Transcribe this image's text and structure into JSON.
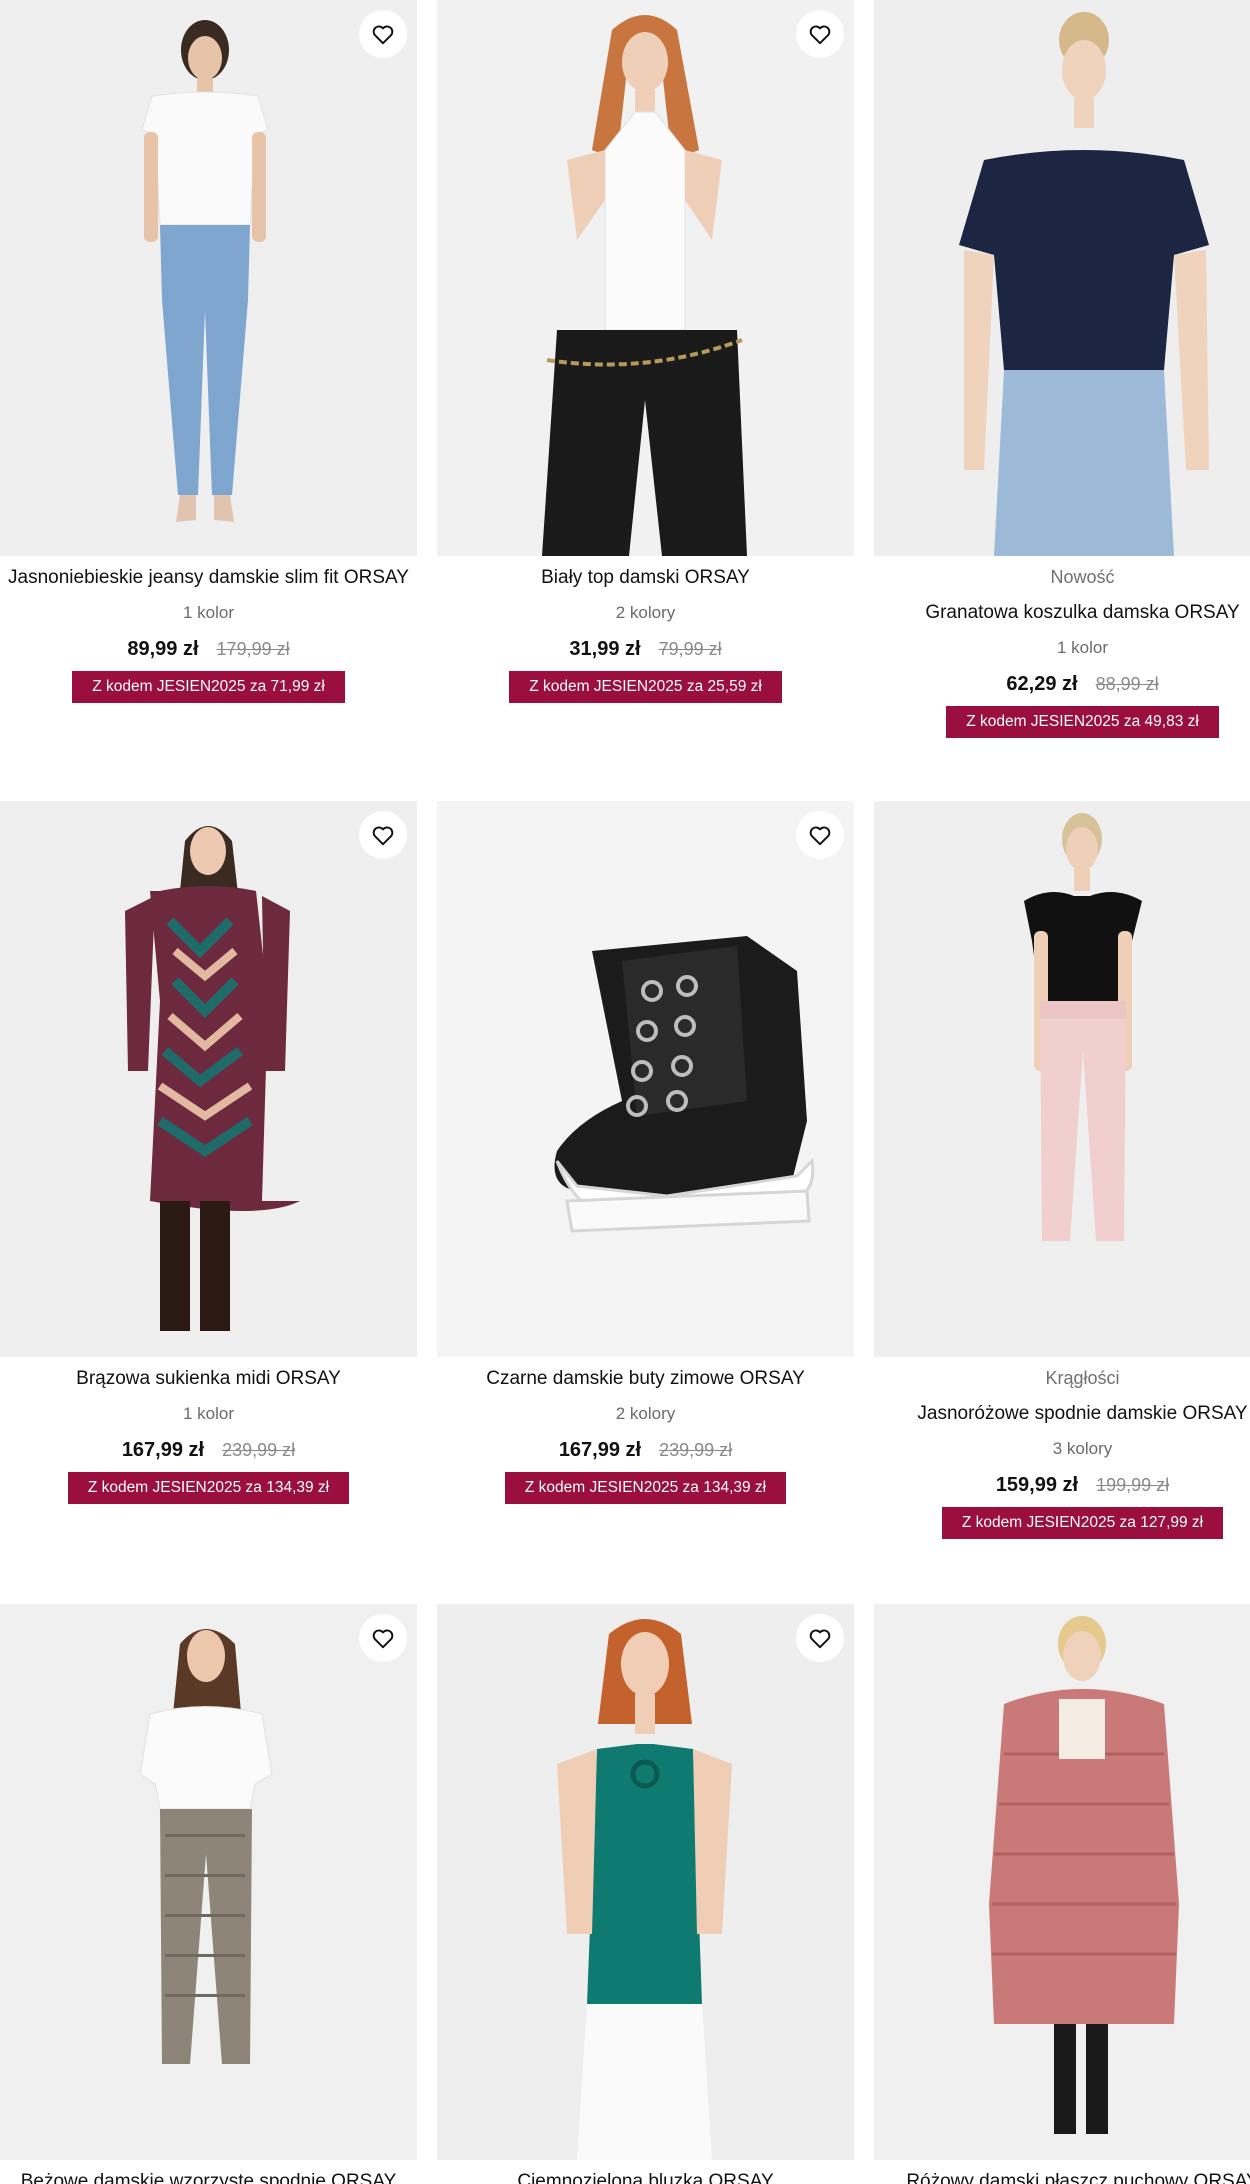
{
  "icons": {
    "favorite": "heart-outline-icon"
  },
  "colors": {
    "promo_bg": "#9b0f3f",
    "image_bg": "#eeeeef",
    "old_price": "#8a8a8a"
  },
  "products": [
    {
      "tag": "",
      "name": "Jasnoniebieskie jeansy damskie slim fit ORSAY",
      "colors": "1 kolor",
      "price": "89,99 zł",
      "old_price": "179,99 zł",
      "promo": "Z kodem JESIEN2025 za 71,99 zł"
    },
    {
      "tag": "",
      "name": "Biały top damski ORSAY",
      "colors": "2 kolory",
      "price": "31,99 zł",
      "old_price": "79,99 zł",
      "promo": "Z kodem JESIEN2025 za 25,59 zł"
    },
    {
      "tag": "Nowość",
      "name": "Granatowa koszulka damska ORSAY",
      "colors": "1 kolor",
      "price": "62,29 zł",
      "old_price": "88,99 zł",
      "promo": "Z kodem JESIEN2025 za 49,83 zł"
    },
    {
      "tag": "",
      "name": "Brązowa sukienka midi ORSAY",
      "colors": "1 kolor",
      "price": "167,99 zł",
      "old_price": "239,99 zł",
      "promo": "Z kodem JESIEN2025 za 134,39 zł"
    },
    {
      "tag": "",
      "name": "Czarne damskie buty zimowe ORSAY",
      "colors": "2 kolory",
      "price": "167,99 zł",
      "old_price": "239,99 zł",
      "promo": "Z kodem JESIEN2025 za 134,39 zł"
    },
    {
      "tag": "Krągłości",
      "name": "Jasnoróżowe spodnie damskie ORSAY",
      "colors": "3 kolory",
      "price": "159,99 zł",
      "old_price": "199,99 zł",
      "promo": "Z kodem JESIEN2025 za 127,99 zł"
    },
    {
      "tag": "",
      "name": "Beżowe damskie wzorzyste spodnie ORSAY",
      "colors": "",
      "price": "",
      "old_price": "",
      "promo": ""
    },
    {
      "tag": "",
      "name": "Ciemnozielona bluzka ORSAY",
      "colors": "",
      "price": "",
      "old_price": "",
      "promo": ""
    },
    {
      "tag": "",
      "name": "Różowy damski płaszcz puchowy ORSAY",
      "colors": "",
      "price": "",
      "old_price": "",
      "promo": ""
    }
  ]
}
